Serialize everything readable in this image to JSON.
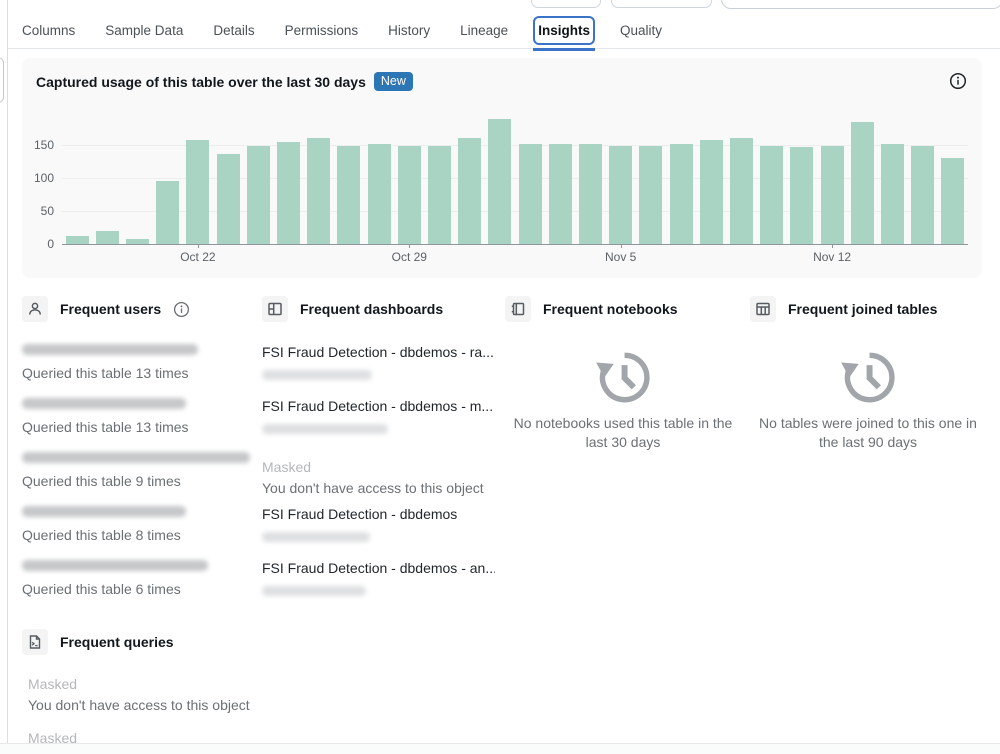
{
  "tabs": {
    "items": [
      {
        "label": "Columns",
        "selected": false
      },
      {
        "label": "Sample Data",
        "selected": false
      },
      {
        "label": "Details",
        "selected": false
      },
      {
        "label": "Permissions",
        "selected": false
      },
      {
        "label": "History",
        "selected": false
      },
      {
        "label": "Lineage",
        "selected": false
      },
      {
        "label": "Insights",
        "selected": true
      },
      {
        "label": "Quality",
        "selected": false
      }
    ]
  },
  "usage_card": {
    "title": "Captured usage of this table over the last 30 days",
    "badge": "New",
    "info_icon": "info-icon"
  },
  "chart_data": {
    "type": "bar",
    "title": "Captured usage of this table over the last 30 days",
    "values": [
      12,
      20,
      8,
      95,
      157,
      137,
      148,
      155,
      160,
      149,
      152,
      149,
      149,
      160,
      190,
      151,
      152,
      152,
      148,
      148,
      152,
      158,
      160,
      148,
      147,
      148,
      185,
      151,
      149,
      131
    ],
    "x_ticks": [
      {
        "index": 4,
        "label": "Oct 22"
      },
      {
        "index": 11,
        "label": "Oct 29"
      },
      {
        "index": 18,
        "label": "Nov 5"
      },
      {
        "index": 25,
        "label": "Nov 12"
      }
    ],
    "y_ticks": [
      0,
      50,
      100,
      150
    ],
    "ylim": [
      0,
      195
    ],
    "bar_color": "#a9d3c3",
    "grid": true,
    "legend": "none",
    "xlabel": "",
    "ylabel": ""
  },
  "sections": {
    "frequent_users": {
      "title": "Frequent users",
      "items": [
        {
          "name_masked": true,
          "detail": "Queried this table 13 times"
        },
        {
          "name_masked": true,
          "detail": "Queried this table 13 times"
        },
        {
          "name_masked": true,
          "detail": "Queried this table 9 times"
        },
        {
          "name_masked": true,
          "detail": "Queried this table 8 times"
        },
        {
          "name_masked": true,
          "detail": "Queried this table 6 times"
        }
      ]
    },
    "frequent_dashboards": {
      "title": "Frequent dashboards",
      "items": [
        {
          "title": "FSI Fraud Detection - dbdemos - ra...",
          "subtitle_masked": true
        },
        {
          "title": "FSI Fraud Detection - dbdemos - m...",
          "subtitle_masked": true
        },
        {
          "masked_label": "Masked",
          "masked_message": "You don't have access to this object"
        },
        {
          "title": "FSI Fraud Detection - dbdemos",
          "subtitle_masked": true
        },
        {
          "title": "FSI Fraud Detection - dbdemos - an...",
          "subtitle_masked": true
        }
      ]
    },
    "frequent_notebooks": {
      "title": "Frequent notebooks",
      "empty_message": "No notebooks used this table in the last 30 days"
    },
    "frequent_joined_tables": {
      "title": "Frequent joined tables",
      "empty_message": "No tables were joined to this one in the last 90 days"
    },
    "frequent_queries": {
      "title": "Frequent queries",
      "items": [
        {
          "masked_label": "Masked",
          "masked_message": "You don't have access to this object"
        },
        {
          "masked_label": "Masked"
        }
      ]
    }
  },
  "colors": {
    "accent_blue": "#3b73c9",
    "badge_blue": "#2d76b5",
    "bar_teal": "#a9d3c3",
    "card_bg": "#f9f9f9",
    "masked_text": "#b4b7ba",
    "secondary_text": "#6b7075"
  }
}
